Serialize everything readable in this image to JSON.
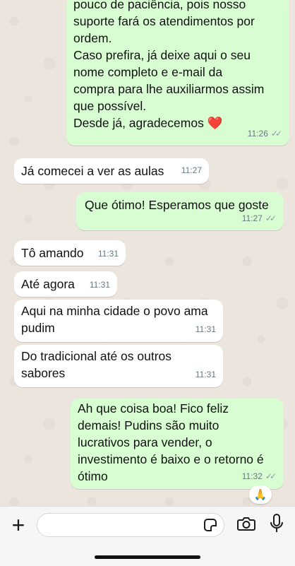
{
  "messages": [
    {
      "id": "m1",
      "dir": "out",
      "text": "pouco de paciência, pois nosso\nsuporte fará os atendimentos por\nordem.\nCaso prefira, já deixe aqui o seu\nnome completo e e-mail da\ncompra para lhe auxiliarmos assim\nque possível.\nDesde já, agradecemos ❤️",
      "time": "11:26",
      "ticks": "✓✓"
    },
    {
      "id": "m2",
      "dir": "in",
      "text": "Já comecei a ver as aulas",
      "time": "11:27"
    },
    {
      "id": "m3",
      "dir": "out",
      "text": "Que ótimo! Esperamos que goste",
      "time": "11:27",
      "ticks": "✓✓"
    },
    {
      "id": "m4",
      "dir": "in",
      "text": "Tô amando",
      "time": "11:31"
    },
    {
      "id": "m5",
      "dir": "in",
      "text": "Até agora",
      "time": "11:31"
    },
    {
      "id": "m6",
      "dir": "in",
      "text": "Aqui na minha cidade o povo ama\npudim",
      "time": "11:31"
    },
    {
      "id": "m7",
      "dir": "in",
      "text": "Do tradicional até os outros\nsabores",
      "time": "11:31"
    },
    {
      "id": "m8",
      "dir": "out",
      "text": "Ah que coisa boa! Fico feliz\ndemais! Pudins são muito\nlucrativos para vender, o\ninvestimento é baixo e o retorno é\nótimo",
      "time": "11:32",
      "ticks": "✓✓"
    }
  ],
  "reaction": "🙏",
  "composer": {
    "plus_label": "+",
    "placeholder": "",
    "icons": [
      "plus-icon",
      "sticker-icon",
      "camera-icon",
      "microphone-icon"
    ]
  },
  "colors": {
    "outgoing_bubble": "#d9fdd3",
    "incoming_bubble": "#ffffff",
    "chat_background": "#ece5dd",
    "timestamp": "#667781"
  }
}
